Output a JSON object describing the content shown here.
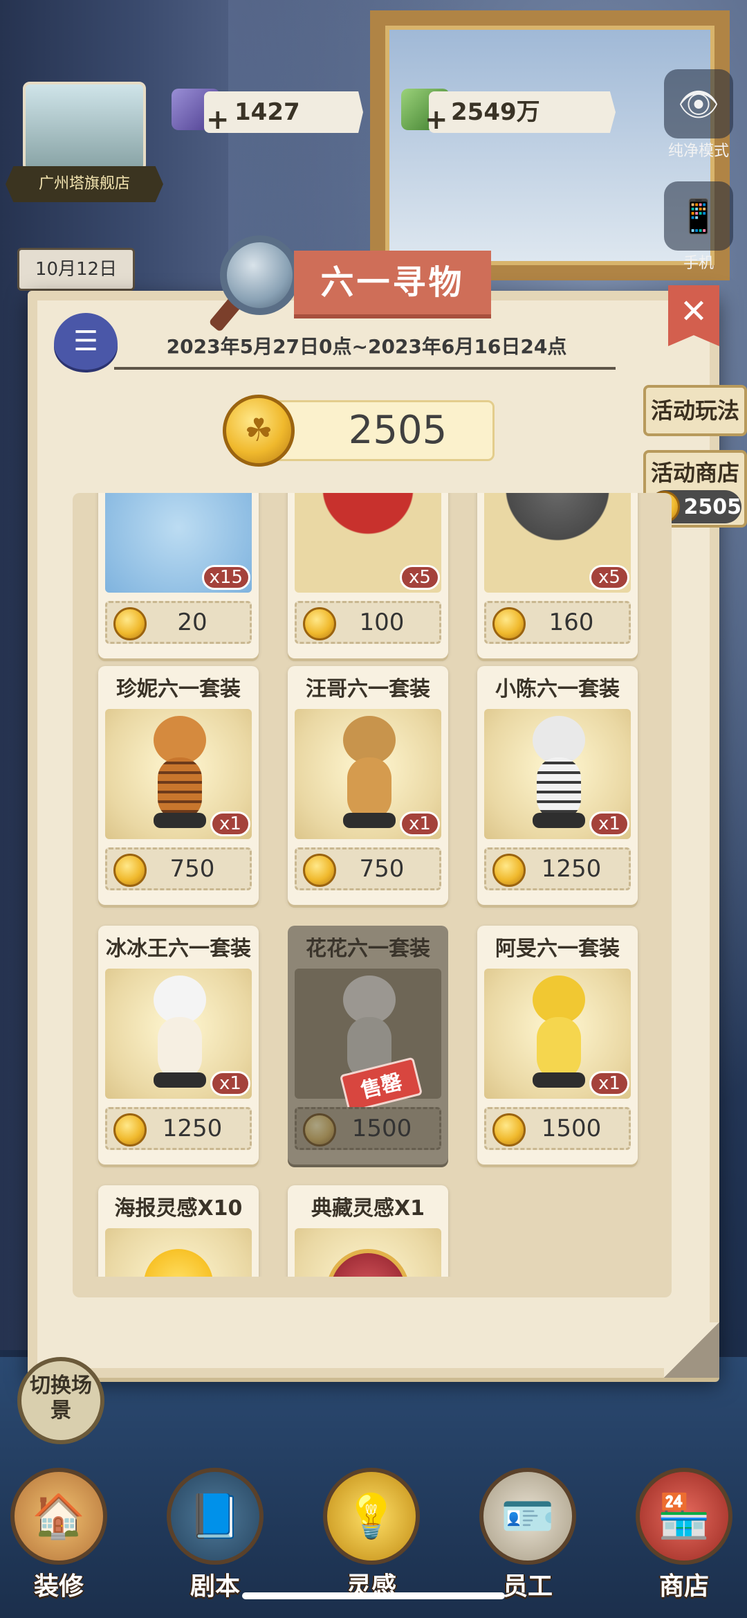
{
  "hud": {
    "store_name": "广州塔旗舰店",
    "date": "10月12日",
    "gems": "1427",
    "money": "2549万",
    "pure_mode": "纯净模式",
    "phone": "手机"
  },
  "event": {
    "title": "六一寻物",
    "time_range": "2023年5月27日0点~2023年6月16日24点",
    "coins": "2505",
    "side_play": "活动玩法",
    "side_shop": "活动商店",
    "side_shop_coins": "2505"
  },
  "items": [
    {
      "name": "",
      "qty": "x15",
      "price": "20",
      "sold": false
    },
    {
      "name": "",
      "qty": "x5",
      "price": "100",
      "sold": false
    },
    {
      "name": "",
      "qty": "x5",
      "price": "160",
      "sold": false
    },
    {
      "name": "珍妮六一套装",
      "qty": "x1",
      "price": "750",
      "sold": false
    },
    {
      "name": "汪哥六一套装",
      "qty": "x1",
      "price": "750",
      "sold": false
    },
    {
      "name": "小陈六一套装",
      "qty": "x1",
      "price": "1250",
      "sold": false
    },
    {
      "name": "冰冰王六一套装",
      "qty": "x1",
      "price": "1250",
      "sold": false
    },
    {
      "name": "花花六一套装",
      "qty": "",
      "price": "1500",
      "sold": true,
      "sold_label": "售罄"
    },
    {
      "name": "阿旻六一套装",
      "qty": "x1",
      "price": "1500",
      "sold": false
    },
    {
      "name": "海报灵感X10",
      "qty": "",
      "price": "",
      "sold": false
    },
    {
      "name": "典藏灵感X1",
      "qty": "",
      "price": "",
      "sold": false
    }
  ],
  "nav": {
    "switch_scene": "切换场景",
    "decorate": "装修",
    "script": "剧本",
    "inspiration": "灵感",
    "staff": "员工",
    "shop": "商店"
  }
}
